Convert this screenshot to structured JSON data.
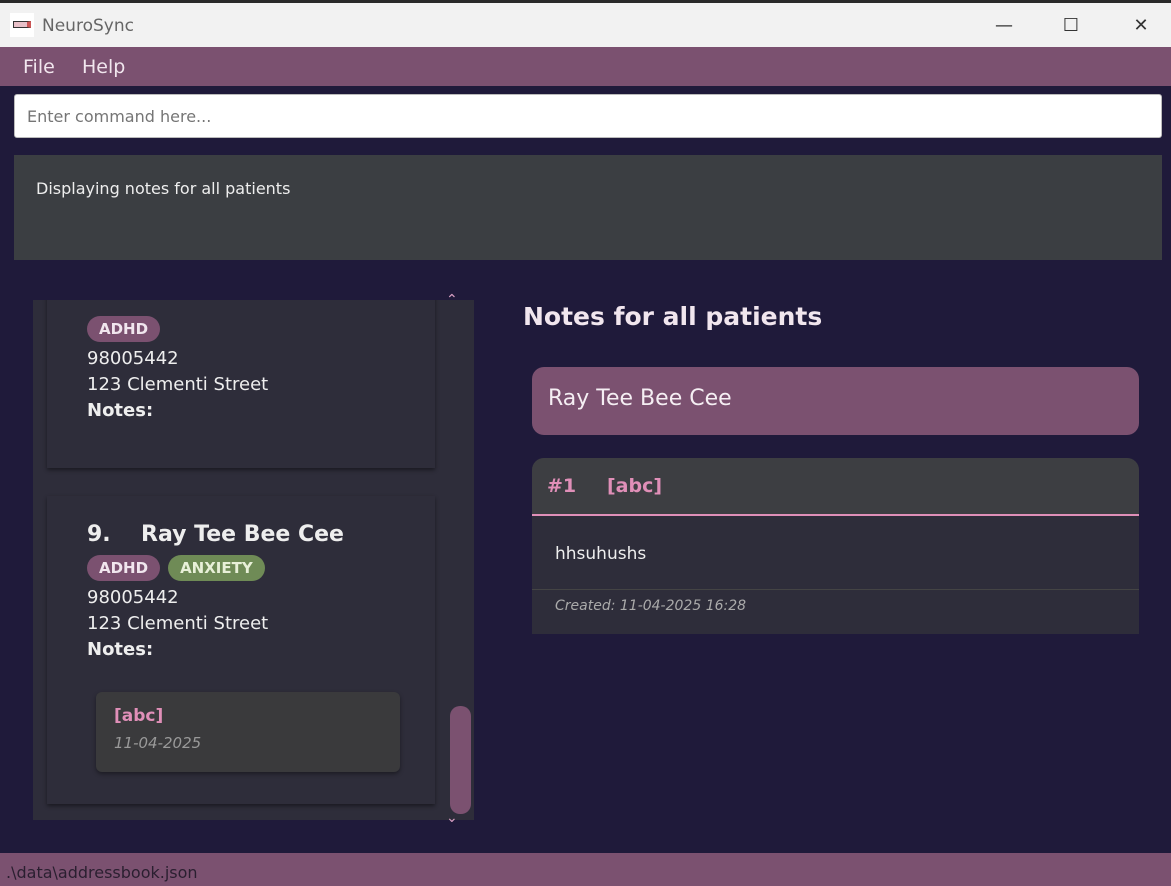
{
  "window": {
    "title": "NeuroSync",
    "controls": {
      "minimize": "—",
      "maximize": "☐",
      "close": "✕"
    }
  },
  "menu": {
    "file": "File",
    "help": "Help"
  },
  "command": {
    "placeholder": "Enter command here..."
  },
  "result": {
    "text": "Displaying notes for all patients"
  },
  "patients": [
    {
      "tags": [
        "ADHD"
      ],
      "phone": "98005442",
      "address": "123 Clementi Street",
      "notes_label": "Notes:"
    },
    {
      "index": "9.",
      "name": "Ray Tee Bee Cee",
      "tags": [
        "ADHD",
        "ANXIETY"
      ],
      "phone": "98005442",
      "address": "123 Clementi Street",
      "notes_label": "Notes:",
      "notes": [
        {
          "title": "[abc]",
          "date": "11-04-2025"
        }
      ]
    }
  ],
  "notes_panel": {
    "title": "Notes for all patients",
    "patient_name": "Ray Tee Bee Cee",
    "notes": [
      {
        "number": "#1",
        "title": "[abc]",
        "content": "hhsuhushs",
        "created": "Created: 11-04-2025 16:28"
      }
    ]
  },
  "status": {
    "path": ".\\data\\addressbook.json"
  },
  "colors": {
    "accent": "#7b5170",
    "background": "#1f1a3a",
    "pink": "#e08fb8",
    "anxiety": "#6f8b56"
  }
}
